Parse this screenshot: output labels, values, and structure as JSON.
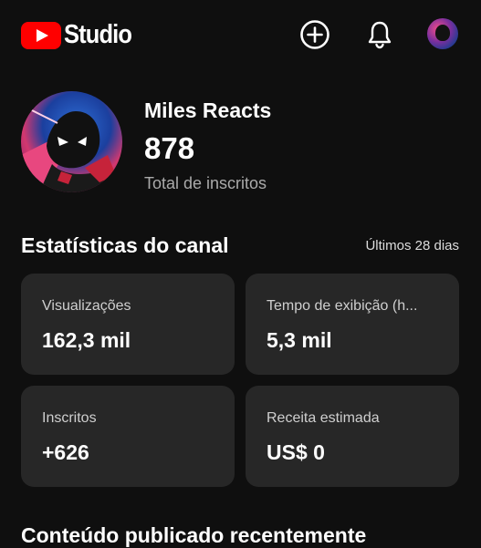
{
  "header": {
    "brand": "Studio",
    "icons": [
      "create-icon",
      "bell-icon",
      "account-avatar"
    ]
  },
  "channel": {
    "name": "Miles Reacts",
    "subscriber_count": "878",
    "subscriber_label": "Total de inscritos"
  },
  "stats": {
    "title": "Estatísticas do canal",
    "period": "Últimos 28 dias",
    "cards": [
      {
        "label": "Visualizações",
        "value": "162,3 mil"
      },
      {
        "label": "Tempo de exibição (h...",
        "value": "5,3 mil"
      },
      {
        "label": "Inscritos",
        "value": "+626"
      },
      {
        "label": "Receita estimada",
        "value": "US$ 0"
      }
    ]
  },
  "recent": {
    "title": "Conteúdo publicado recentemente"
  },
  "colors": {
    "background": "#0f0f0f",
    "card": "#272727",
    "brand_red": "#ff0000",
    "text_primary": "#ffffff",
    "text_secondary": "#aaaaaa"
  }
}
